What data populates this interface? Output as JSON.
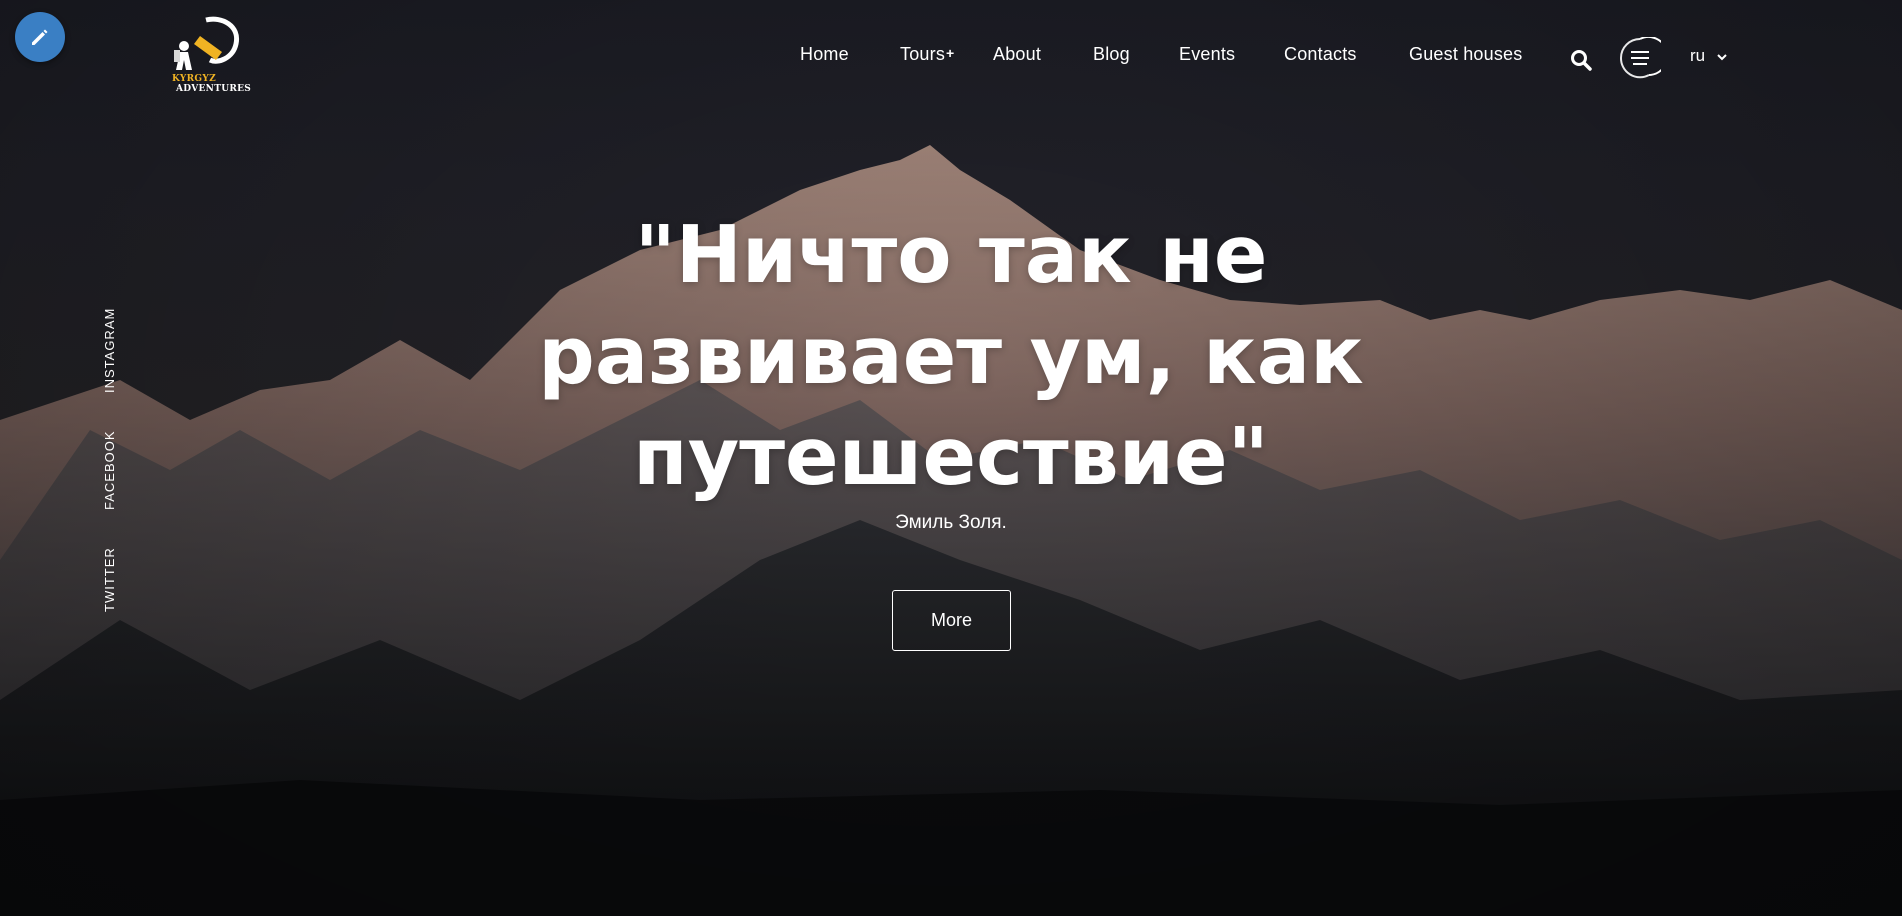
{
  "logo": {
    "line1": "KYRGYZ",
    "line2": "ADVENTURES"
  },
  "nav": {
    "items": [
      {
        "label": "Home"
      },
      {
        "label": "Tours",
        "has_submenu": true,
        "submenu_marker": "+"
      },
      {
        "label": "About"
      },
      {
        "label": "Blog"
      },
      {
        "label": "Events"
      },
      {
        "label": "Contacts"
      },
      {
        "label": "Guest houses"
      }
    ],
    "language": "ru"
  },
  "social": {
    "items": [
      {
        "label": "INSTAGRAM"
      },
      {
        "label": "FACEBOOK"
      },
      {
        "label": "TWITTER"
      }
    ]
  },
  "hero": {
    "quote_lines": [
      "\"Ничто так не",
      "развивает ум, как",
      "путешествие\""
    ],
    "author": "Эмиль Золя.",
    "button_label": "More"
  },
  "icons": {
    "edit": "pencil-icon",
    "search": "search-icon",
    "menu": "hamburger-menu-icon",
    "language_dropdown": "chevron-down-icon"
  },
  "colors": {
    "edit_button": "#3a7fc4",
    "logo_accent": "#f0b323",
    "text": "#ffffff",
    "background": "#1b1c24"
  }
}
